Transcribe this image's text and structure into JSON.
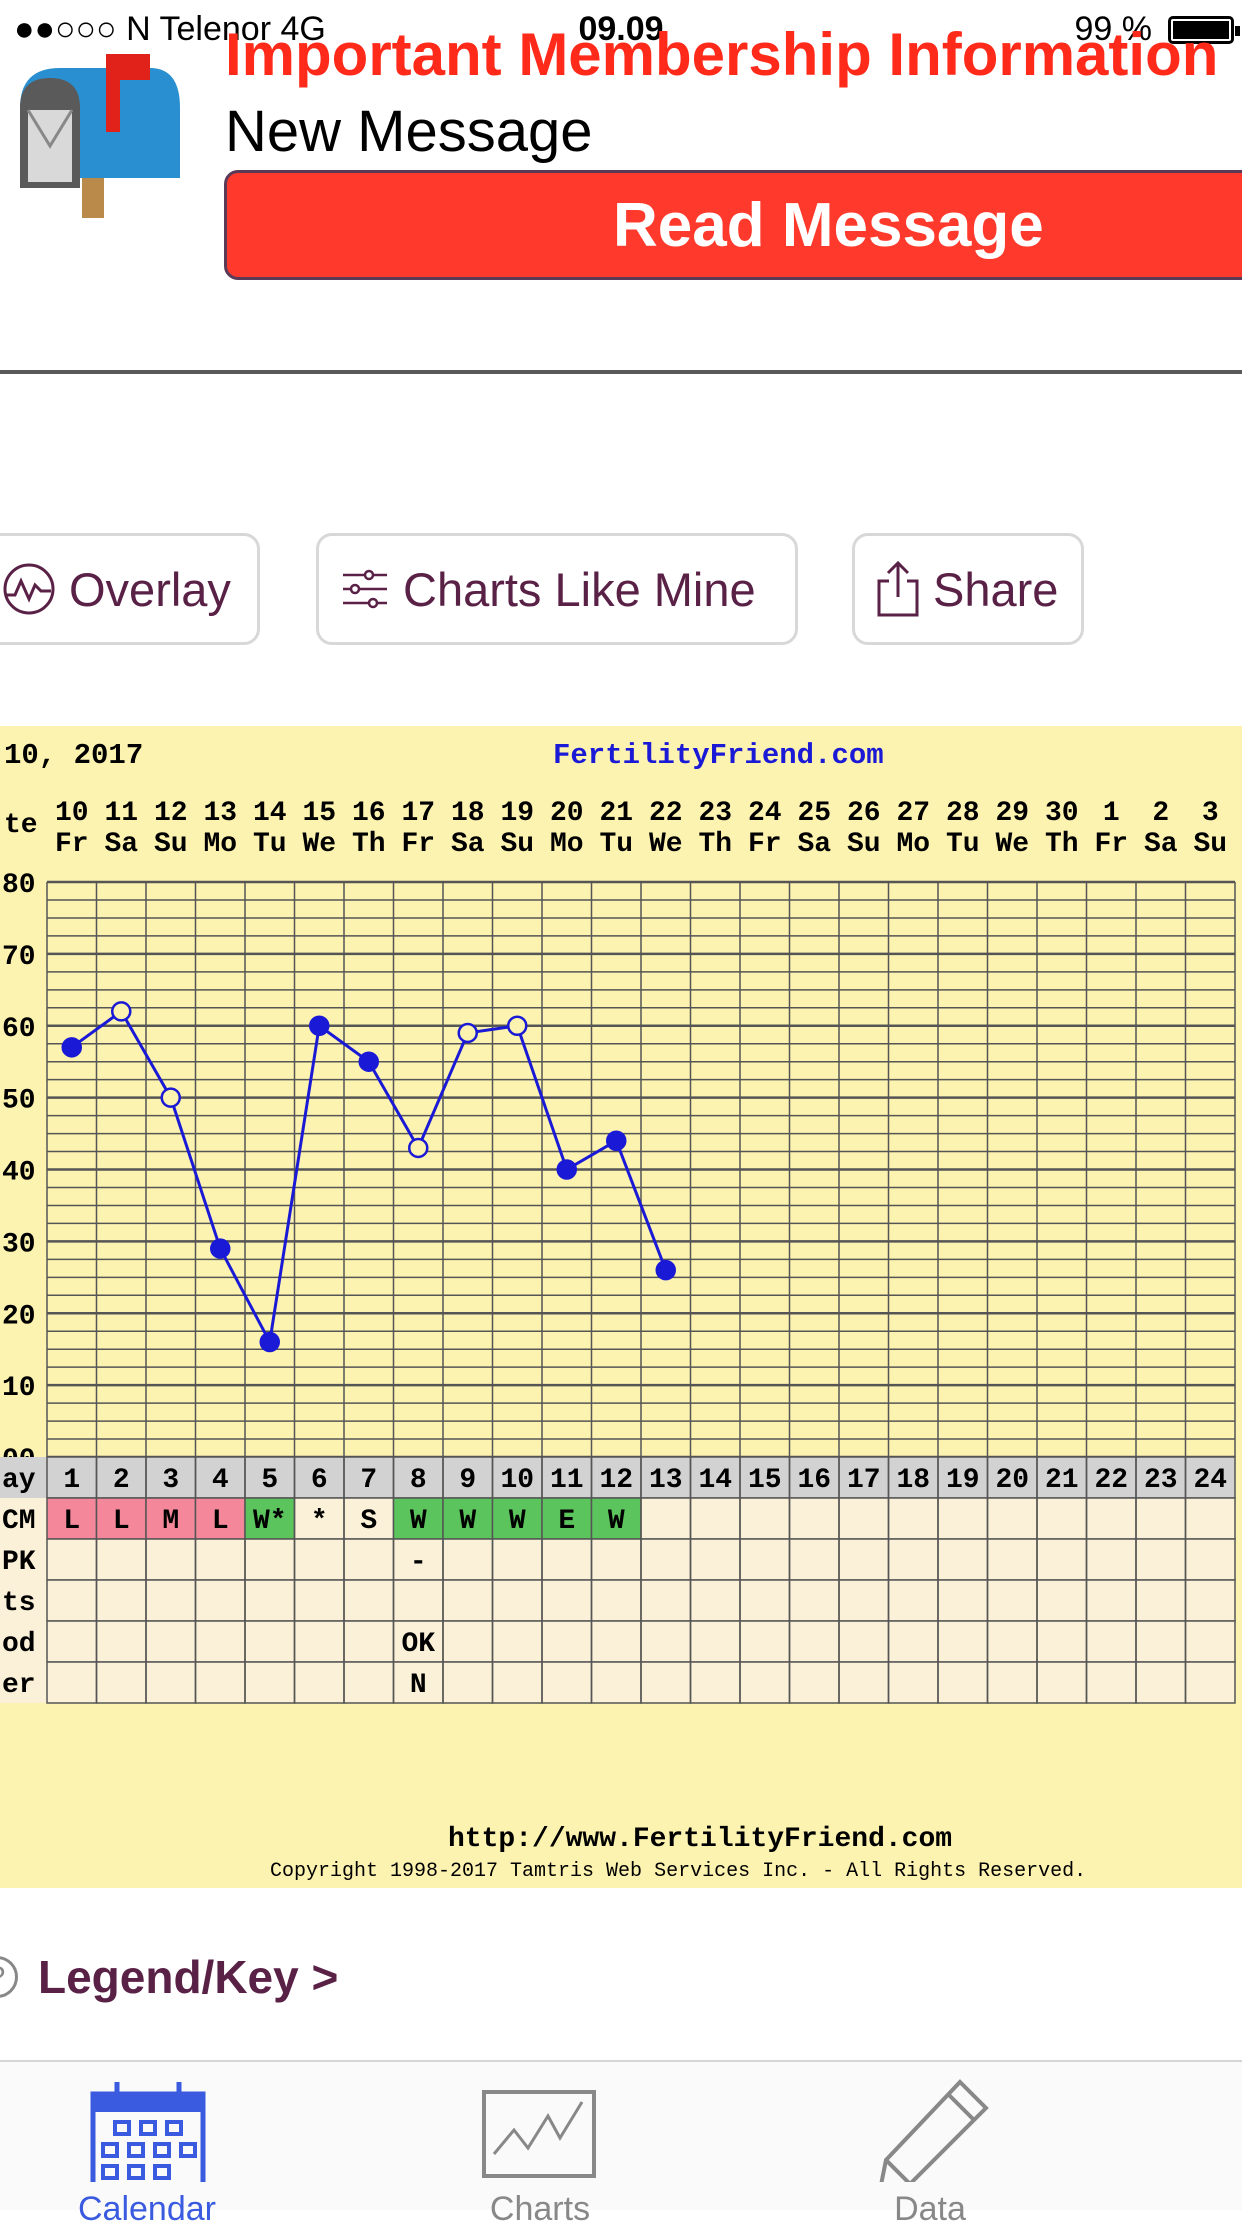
{
  "status_bar": {
    "carrier": "●●○○○ N Telenor  4G",
    "time": "09.09",
    "battery": "99 %"
  },
  "banner": {
    "title": "Important Membership Information",
    "subtitle": "New Message",
    "button_label": "Read Message",
    "colors": {
      "title": "#ff2a1a",
      "button": "#ff3a2c"
    }
  },
  "actions": {
    "overlay_label": "Overlay",
    "charts_like_mine_label": "Charts Like Mine",
    "share_label": "Share"
  },
  "legend": {
    "label": "Legend/Key >",
    "icon": "?"
  },
  "tabs": [
    {
      "label": "Calendar",
      "icon": "calendar-icon",
      "active": true
    },
    {
      "label": "Charts",
      "icon": "chart-icon",
      "active": false
    },
    {
      "label": "Data",
      "icon": "pencil-icon",
      "active": false
    }
  ],
  "chart_data": {
    "type": "line",
    "title_left": "10, 2017",
    "title_right": "FertilityFriend.com",
    "footer_url": "http://www.FertilityFriend.com",
    "footer_copyright": "Copyright 1998-2017 Tamtris Web Services Inc. - All Rights Reserved.",
    "header_row_label": "te",
    "dates": [
      "10",
      "11",
      "12",
      "13",
      "14",
      "15",
      "16",
      "17",
      "18",
      "19",
      "20",
      "21",
      "22",
      "23",
      "24",
      "25",
      "26",
      "27",
      "28",
      "29",
      "30",
      "1",
      "2",
      "3"
    ],
    "weekdays": [
      "Fr",
      "Sa",
      "Su",
      "Mo",
      "Tu",
      "We",
      "Th",
      "Fr",
      "Sa",
      "Su",
      "Mo",
      "Tu",
      "We",
      "Th",
      "Fr",
      "Sa",
      "Su",
      "Mo",
      "Tu",
      "We",
      "Th",
      "Fr",
      "Sa",
      "Su"
    ],
    "y_tick_labels": [
      "80",
      "70",
      "60",
      "50",
      "40",
      "30",
      "20",
      "10",
      "00"
    ],
    "ylim": [
      0,
      80
    ],
    "values": [
      57,
      62,
      50,
      29,
      16,
      60,
      55,
      43,
      59,
      60,
      40,
      44,
      26
    ],
    "open_markers": [
      false,
      true,
      true,
      false,
      false,
      false,
      false,
      true,
      true,
      true,
      false,
      false,
      false
    ],
    "cycle_days": [
      "1",
      "2",
      "3",
      "4",
      "5",
      "6",
      "7",
      "8",
      "9",
      "10",
      "11",
      "12",
      "13",
      "14",
      "15",
      "16",
      "17",
      "18",
      "19",
      "20",
      "21",
      "22",
      "23",
      "24"
    ],
    "rows": [
      {
        "label": "ay",
        "key": "day"
      },
      {
        "label": "CM",
        "key": "cm",
        "cells": [
          "L",
          "L",
          "M",
          "L",
          "W*",
          "*",
          "S",
          "W",
          "W",
          "W",
          "E",
          "W"
        ],
        "colors": [
          "#f4879a",
          "#f4879a",
          "#f4879a",
          "#f4879a",
          "#5cc45c",
          "",
          "",
          "#5cc45c",
          "#5cc45c",
          "#5cc45c",
          "#5cc45c",
          "#5cc45c"
        ]
      },
      {
        "label": "PK",
        "key": "opk",
        "cells": [
          "",
          "",
          "",
          "",
          "",
          "",
          "",
          "-"
        ]
      },
      {
        "label": "ts",
        "key": "tests",
        "cells": []
      },
      {
        "label": "od",
        "key": "mood",
        "cells": [
          "",
          "",
          "",
          "",
          "",
          "",
          "",
          "OK"
        ]
      },
      {
        "label": "er",
        "key": "other",
        "cells": [
          "",
          "",
          "",
          "",
          "",
          "",
          "",
          "N"
        ]
      }
    ],
    "line_color": "#1a1ad6",
    "grid": true
  }
}
